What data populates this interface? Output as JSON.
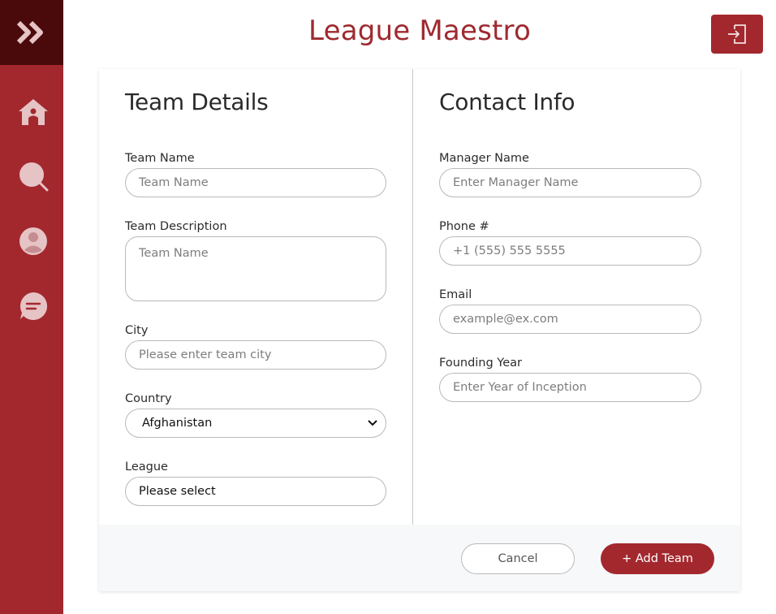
{
  "app": {
    "title": "League Maestro"
  },
  "sidebar": {
    "items": [
      {
        "icon": "home-icon"
      },
      {
        "icon": "search-icon"
      },
      {
        "icon": "user-icon"
      },
      {
        "icon": "chat-icon"
      }
    ]
  },
  "team_details": {
    "title": "Team Details",
    "team_name": {
      "label": "Team Name",
      "placeholder": "Team Name",
      "value": ""
    },
    "team_description": {
      "label": "Team Description",
      "placeholder": "Team Name",
      "value": ""
    },
    "city": {
      "label": "City",
      "placeholder": "Please enter team city",
      "value": ""
    },
    "country": {
      "label": "Country",
      "selected": "Afghanistan"
    },
    "league": {
      "label": "League",
      "selected": "Please select"
    }
  },
  "contact_info": {
    "title": "Contact Info",
    "manager_name": {
      "label": "Manager Name",
      "placeholder": "Enter Manager Name",
      "value": ""
    },
    "phone": {
      "label": "Phone #",
      "placeholder": "+1 (555) 555 5555",
      "value": ""
    },
    "email": {
      "label": "Email",
      "placeholder": "example@ex.com",
      "value": ""
    },
    "founding_year": {
      "label": "Founding Year",
      "placeholder": "Enter Year of Inception",
      "value": ""
    }
  },
  "actions": {
    "cancel_label": "Cancel",
    "add_label": "+ Add Team"
  },
  "colors": {
    "brand": "#a3282e",
    "brand_dark": "#4a0a0c",
    "icon_tint": "#e6c3c5"
  }
}
